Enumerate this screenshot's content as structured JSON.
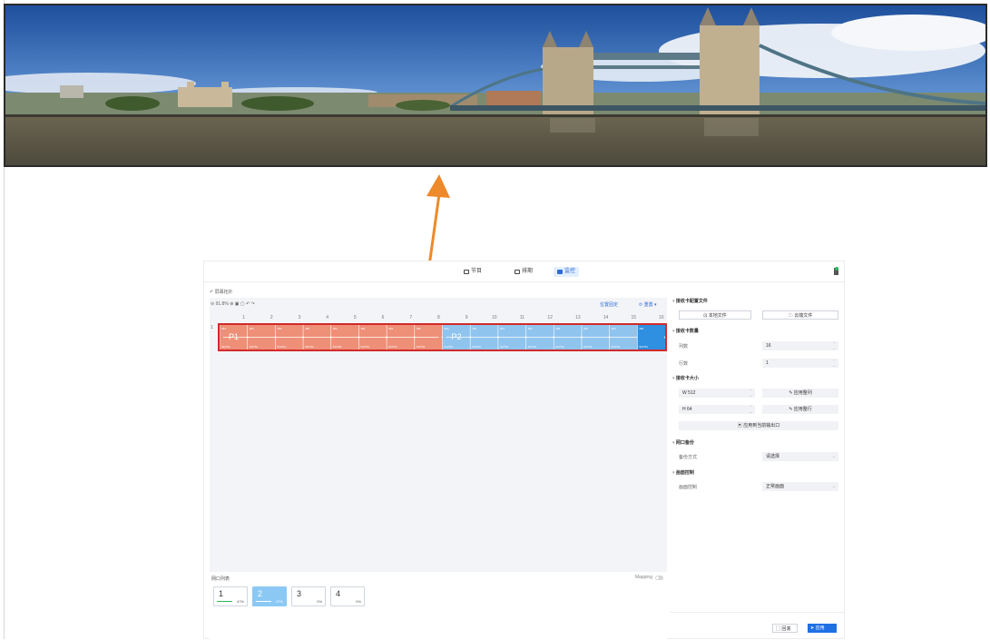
{
  "app": {
    "tabs": [
      {
        "label": "节目",
        "icon": "monitor-icon"
      },
      {
        "label": "排期",
        "icon": "calendar-icon"
      },
      {
        "label": "监控",
        "icon": "monitor-screen-icon"
      }
    ],
    "active_tab": "监控",
    "back_link": "屏幕拓扑",
    "toolbar": {
      "zoom": "91.8%",
      "locate_label": "位置固定",
      "reset_label": "重置"
    },
    "ruler_columns": [
      "1",
      "2",
      "3",
      "4",
      "5",
      "6",
      "7",
      "8",
      "9",
      "10",
      "11",
      "12",
      "13",
      "14",
      "15",
      "16"
    ],
    "ruler_rows": [
      "1"
    ],
    "receiver_strip": {
      "sections": [
        {
          "label": "P1",
          "color": "#ee8f78",
          "columns": 8
        },
        {
          "label": "P2",
          "color": "#8fc4ee",
          "columns": 8
        }
      ],
      "highlight_color": "#d12a2a",
      "cell_top_value": "384",
      "cell_bottom_value": "512*64"
    },
    "outputs": {
      "label": "网口列表",
      "mapping_label": "Mapping",
      "mapping_on": false,
      "cards": [
        {
          "num": "1",
          "pct": "47%",
          "progress": 0.47,
          "selected": false
        },
        {
          "num": "2",
          "pct": "47%",
          "progress": 0.47,
          "selected": true
        },
        {
          "num": "3",
          "pct": "0%",
          "progress": 0,
          "selected": false
        },
        {
          "num": "4",
          "pct": "0%",
          "progress": 0,
          "selected": false
        }
      ]
    },
    "right_panel": {
      "config_file_title": "接收卡配置文件",
      "local_file_label": "本地文件",
      "cloud_file_label": "云端文件",
      "count_title": "接收卡数量",
      "cols_label": "列数",
      "cols_value": "16",
      "rows_label": "行数",
      "rows_value": "1",
      "size_title": "接收卡大小",
      "width_value": "W 512",
      "height_value": "H 64",
      "apply_col_label": "应用整列",
      "apply_row_label": "应用整行",
      "apply_output_label": "应用到当前输出口",
      "backup_title": "网口备份",
      "backup_mode_label": "备份方式",
      "backup_mode_value": "请选择",
      "picture_title": "画面控制",
      "picture_control_label": "画面控制",
      "picture_control_value": "正常画面"
    },
    "footer": {
      "reset_label": "回滚",
      "apply_label": "应用"
    },
    "accent": "#1f6fe5",
    "arrow_color": "#ee8a2a"
  }
}
